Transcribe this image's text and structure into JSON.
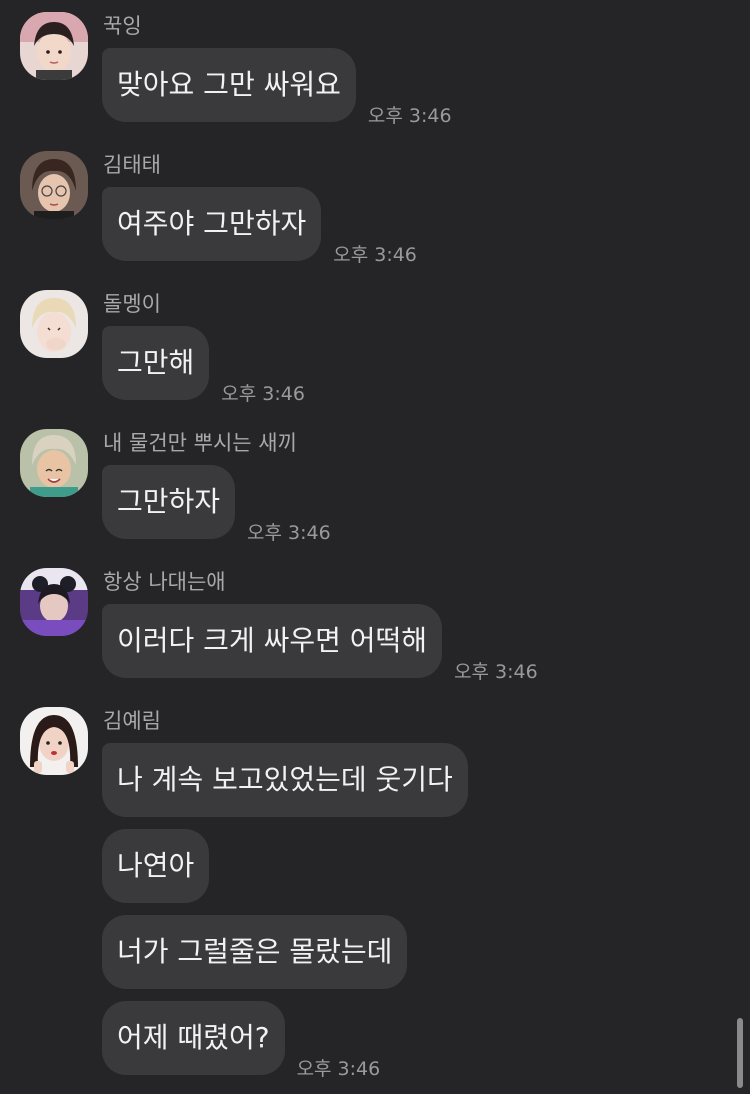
{
  "messages": [
    {
      "sender": "꾹잉",
      "avatar": "avatar-photo",
      "texts": [
        "맞아요 그만 싸워요"
      ],
      "time": "오후 3:46"
    },
    {
      "sender": "김태태",
      "avatar": "avatar-photo",
      "texts": [
        "여주야 그만하자"
      ],
      "time": "오후 3:46"
    },
    {
      "sender": "돌멩이",
      "avatar": "avatar-photo",
      "texts": [
        "그만해"
      ],
      "time": "오후 3:46"
    },
    {
      "sender": "내 물건만 뿌시는 새끼",
      "avatar": "avatar-photo",
      "texts": [
        "그만하자"
      ],
      "time": "오후 3:46"
    },
    {
      "sender": "항상 나대는애",
      "avatar": "avatar-photo",
      "texts": [
        "이러다 크게 싸우면 어떡해"
      ],
      "time": "오후 3:46"
    },
    {
      "sender": "김예림",
      "avatar": "avatar-photo",
      "texts": [
        "나 계속 보고있었는데 웃기다",
        "나연아",
        "너가 그럴줄은 몰랐는데",
        "어제 때렸어?"
      ],
      "time": "오후 3:46"
    }
  ],
  "colors": {
    "background": "#252527",
    "bubble": "#3a3a3c",
    "text": "#f2f2f2",
    "meta": "#9a9a9a"
  }
}
